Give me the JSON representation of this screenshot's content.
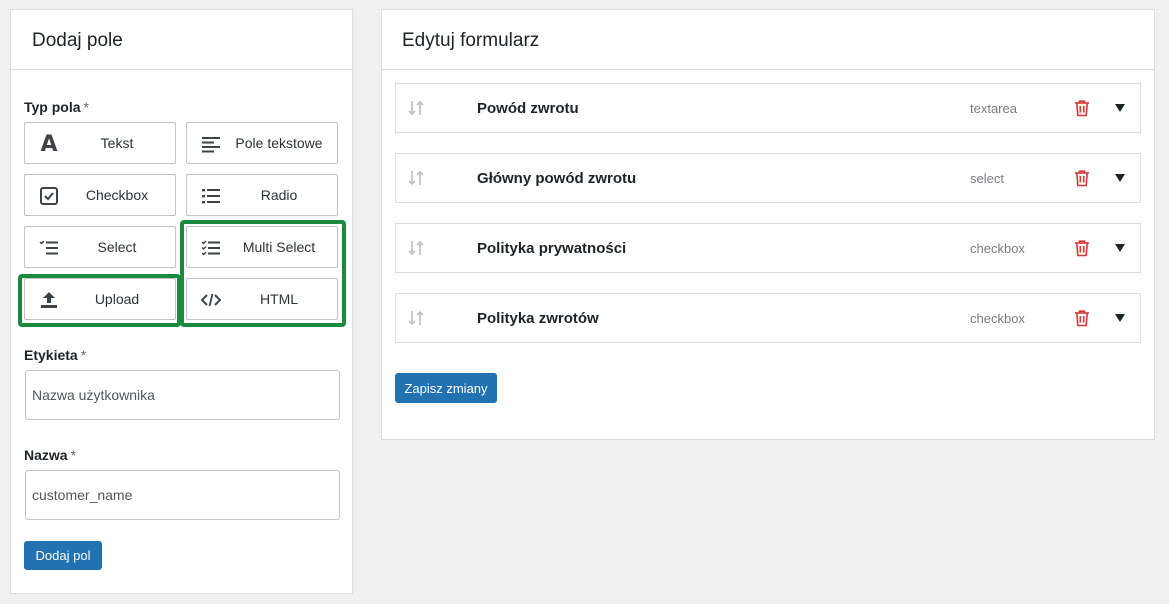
{
  "add_field_panel": {
    "title": "Dodaj pole",
    "type_label": "Typ pola",
    "required_mark": "*",
    "types": [
      {
        "label": "Tekst",
        "icon": "text-a-icon"
      },
      {
        "label": "Pole tekstowe",
        "icon": "align-left-icon"
      },
      {
        "label": "Checkbox",
        "icon": "checkbox-icon"
      },
      {
        "label": "Radio",
        "icon": "list-icon"
      },
      {
        "label": "Select",
        "icon": "select-list-icon"
      },
      {
        "label": "Multi Select",
        "icon": "multi-select-icon"
      },
      {
        "label": "Upload",
        "icon": "upload-icon"
      },
      {
        "label": "HTML",
        "icon": "code-icon"
      }
    ],
    "label_field": {
      "label": "Etykieta",
      "placeholder": "Nazwa użytkownika"
    },
    "name_field": {
      "label": "Nazwa",
      "placeholder": "customer_name"
    },
    "submit_label": "Dodaj pol"
  },
  "edit_form_panel": {
    "title": "Edytuj formularz",
    "fields": [
      {
        "name": "Powód zwrotu",
        "type": "textarea"
      },
      {
        "name": "Główny powód zwrotu",
        "type": "select"
      },
      {
        "name": "Polityka prywatności",
        "type": "checkbox"
      },
      {
        "name": "Polityka zwrotów",
        "type": "checkbox"
      }
    ],
    "save_label": "Zapisz zmiany"
  },
  "colors": {
    "primary": "#2271b1",
    "highlight": "#1a8a3e",
    "delete": "#d63638"
  }
}
